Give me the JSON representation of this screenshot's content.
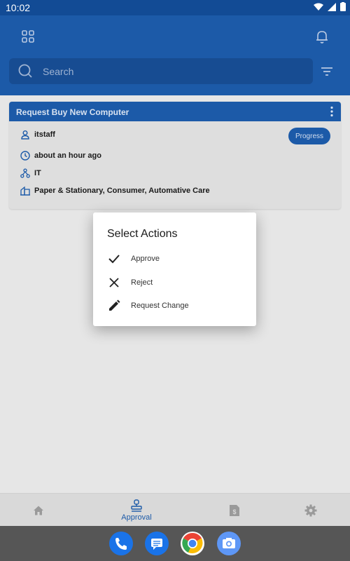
{
  "status_bar": {
    "time": "10:02"
  },
  "search": {
    "placeholder": "Search"
  },
  "request_card": {
    "title": "Request Buy New Computer",
    "status_badge": "Progress",
    "requester": "itstaff",
    "time_ago": "about an hour ago",
    "department": "IT",
    "category": "Paper & Stationary, Consumer, Automative Care"
  },
  "dialog": {
    "title": "Select Actions",
    "items": [
      {
        "label": "Approve",
        "icon": "check-icon"
      },
      {
        "label": "Reject",
        "icon": "close-icon"
      },
      {
        "label": "Request Change",
        "icon": "pencil-icon"
      }
    ]
  },
  "bottom_nav": {
    "items": [
      {
        "icon": "home-icon",
        "label": ""
      },
      {
        "icon": "approval-stamp-icon",
        "label": "Approval",
        "active": true
      },
      {
        "icon": "receipt-dollar-icon",
        "label": ""
      },
      {
        "icon": "settings-gear-icon",
        "label": ""
      }
    ]
  },
  "dock": {
    "apps": [
      "phone-app-icon",
      "messages-app-icon",
      "chrome-app-icon",
      "camera-app-icon"
    ]
  },
  "colors": {
    "primary": "#1c5aa8",
    "status_bar": "#124b95",
    "dock": "#565656"
  }
}
